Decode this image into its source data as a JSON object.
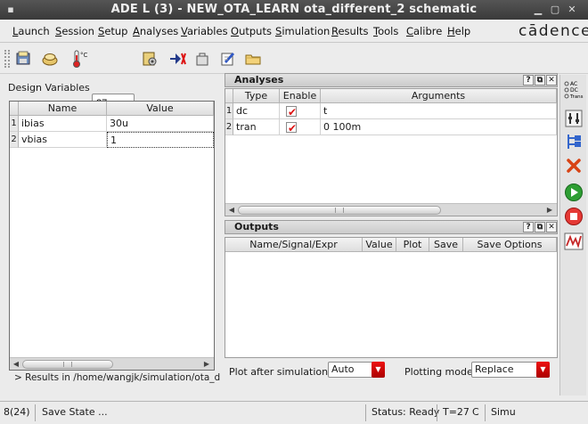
{
  "window": {
    "title": "ADE L (3) - NEW_OTA_LEARN ota_different_2 schematic",
    "app_menu_icon": "app-menu-icon",
    "controls": [
      "minimize-icon",
      "maximize-icon",
      "close-icon"
    ]
  },
  "menubar": {
    "items": [
      "Launch",
      "Session",
      "Setup",
      "Analyses",
      "Variables",
      "Outputs",
      "Simulation",
      "Results",
      "Tools",
      "Calibre",
      "Help"
    ],
    "logo": "cādence"
  },
  "toolbar": {
    "temperature_unit": "°C",
    "temperature": "27",
    "icons": [
      "open-state-icon",
      "load-icon",
      "temperature-icon",
      "setup-models-icon",
      "netlist-icon",
      "save-icon",
      "edit-icon",
      "folder-icon"
    ]
  },
  "design_variables": {
    "label": "Design Variables",
    "columns": [
      "Name",
      "Value"
    ],
    "rows": [
      {
        "num": "1",
        "name": "ibias",
        "value": "30u"
      },
      {
        "num": "2",
        "name": "vbias",
        "value": "1"
      }
    ]
  },
  "results_path": "> Results in /home/wangjk/simulation/ota_differ",
  "analyses": {
    "title": "Analyses",
    "columns": [
      "Type",
      "Enable",
      "Arguments"
    ],
    "rows": [
      {
        "num": "1",
        "type": "dc",
        "enabled": true,
        "arguments": "t"
      },
      {
        "num": "2",
        "type": "tran",
        "enabled": true,
        "arguments": "0 100m"
      }
    ]
  },
  "outputs": {
    "title": "Outputs",
    "columns": [
      "Name/Signal/Expr",
      "Value",
      "Plot",
      "Save",
      "Save Options"
    ],
    "rows": []
  },
  "plot_after_simulation": {
    "label": "Plot after simulation:",
    "value": "Auto"
  },
  "plotting_mode": {
    "label": "Plotting mode:",
    "value": "Replace"
  },
  "right_toolbar": {
    "items": [
      {
        "icon": "ac-dc-trans-icon",
        "labels": [
          "AC",
          "DC",
          "Trans"
        ]
      },
      {
        "icon": "parametric-icon",
        "labels": []
      },
      {
        "icon": "netlist-tree-icon",
        "labels": []
      },
      {
        "icon": "delete-icon",
        "labels": []
      },
      {
        "icon": "run-icon",
        "labels": []
      },
      {
        "icon": "stop-icon",
        "labels": []
      },
      {
        "icon": "waveform-icon",
        "labels": []
      }
    ]
  },
  "statusbar": {
    "mouse": "8(24)",
    "command": "Save State ...",
    "status": "Status: Ready",
    "temp": "T=27",
    "unit": "C",
    "simulator": "Simu"
  },
  "colors": {
    "accent_red": "#d11111",
    "run_green": "#2e9e33",
    "title_bar": "#3a3a3a"
  }
}
